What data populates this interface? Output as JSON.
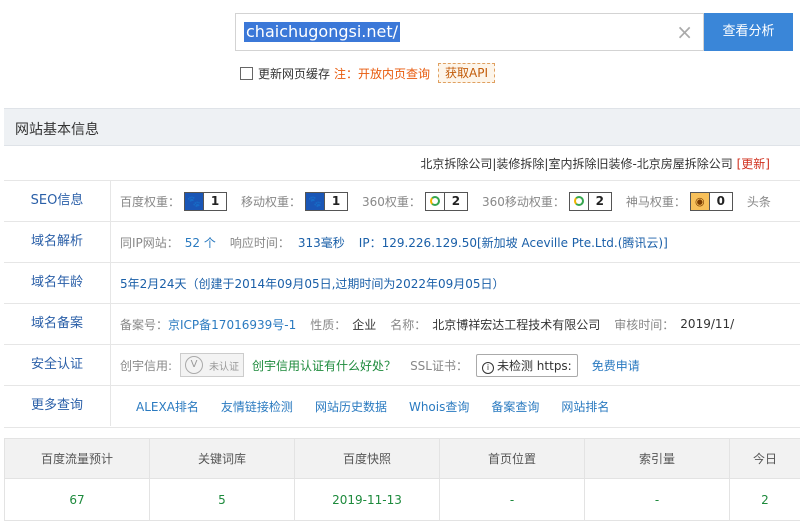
{
  "search": {
    "value": "chaichugongsi.net/",
    "clear_icon": "×",
    "button": "查看分析"
  },
  "options": {
    "refresh_label": "更新网页缓存",
    "note": "注：开放内页查询",
    "api_button": "获取API"
  },
  "panel": {
    "title": "网站基本信息",
    "site_title": "北京拆除公司|装修拆除|室内拆除旧装修-北京房屋拆除公司",
    "update_link": "[更新]"
  },
  "seo": {
    "label": "SEO信息",
    "baidu_label": "百度权重：",
    "baidu_value": "1",
    "mobile_label": "移动权重：",
    "mobile_value": "1",
    "s360_label": "360权重：",
    "s360_value": "2",
    "s360m_label": "360移动权重：",
    "s360m_value": "2",
    "shenma_label": "神马权重：",
    "shenma_value": "0",
    "toutiao_label": "头条"
  },
  "dns": {
    "label": "域名解析",
    "same_ip_label": "同IP网站：",
    "same_ip_value": "52 个",
    "resp_label": "响应时间：",
    "resp_value": "313毫秒",
    "ip_text": "IP：129.226.129.50[新加坡 Aceville Pte.Ltd.(腾讯云)]"
  },
  "age": {
    "label": "域名年龄",
    "text": "5年2月24天（创建于2014年09月05日,过期时间为2022年09月05日）"
  },
  "icp": {
    "label": "域名备案",
    "no_label": "备案号：",
    "no_value": "京ICP备17016939号-1",
    "nature_label": "性质：",
    "nature_value": "企业",
    "name_label": "名称：",
    "name_value": "北京博祥宏达工程技术有限公司",
    "audit_label": "审核时间：",
    "audit_value": "2019/11/"
  },
  "security": {
    "label": "安全认证",
    "credit_label": "创宇信用:",
    "badge_text": "未认证",
    "credit_link": "创宇信用认证有什么好处？",
    "ssl_label": "SSL证书：",
    "ssl_button": "未检测 https:",
    "free_apply": "免费申请"
  },
  "more": {
    "label": "更多查询",
    "links": [
      "ALEXA排名",
      "友情链接检测",
      "网站历史数据",
      "Whois查询",
      "备案查询",
      "网站排名"
    ]
  },
  "stats": {
    "headers": [
      "百度流量预计",
      "关键词库",
      "百度快照",
      "首页位置",
      "索引量",
      "今日"
    ],
    "values": [
      "67",
      "5",
      "2019-11-13",
      "-",
      "-",
      "2"
    ]
  }
}
